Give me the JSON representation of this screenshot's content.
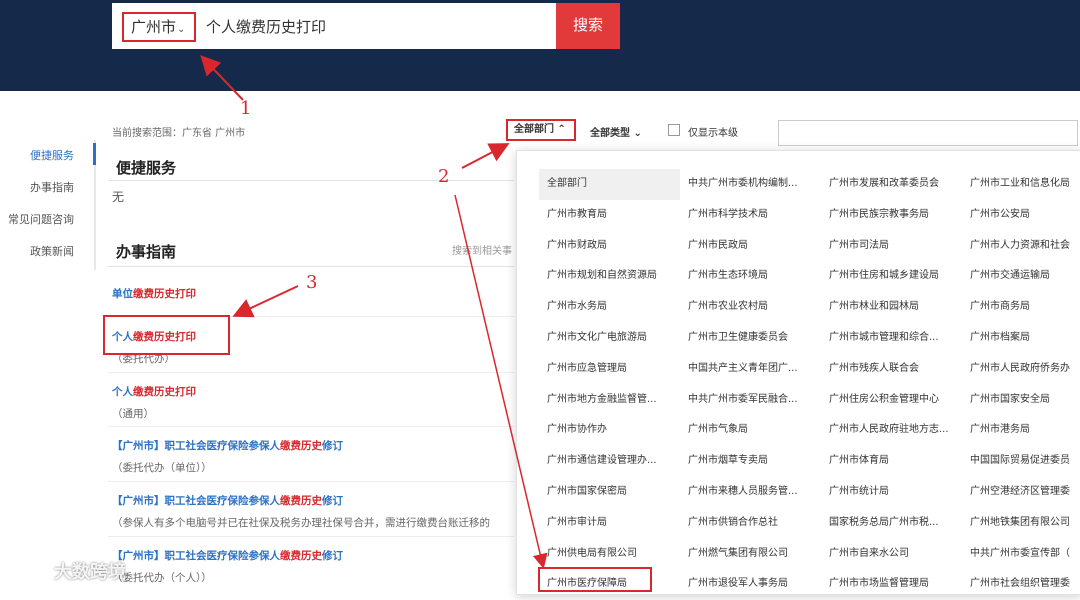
{
  "header": {
    "city": "广州市",
    "search_value": "个人缴费历史打印",
    "search_button": "搜索"
  },
  "left_nav": {
    "items": [
      "便捷服务",
      "办事指南",
      "常见问题咨询",
      "政策新闻"
    ],
    "active": "便捷服务"
  },
  "filters": {
    "scope": "当前搜索范围：广东省 广州市",
    "dept": "全部部门",
    "type": "全部类型",
    "only_this_level": "仅显示本级"
  },
  "sections": {
    "quick_service_title": "便捷服务",
    "quick_service_empty": "无",
    "guide_title": "办事指南",
    "guide_hint": "搜索到相关事"
  },
  "results": [
    {
      "prefix": "单位",
      "highlight": "缴费历史打印",
      "suffix": "",
      "sub": ""
    },
    {
      "prefix": "个人",
      "highlight": "缴费历史打印",
      "suffix": "",
      "sub": "（委托代办）"
    },
    {
      "prefix": "个人",
      "highlight": "缴费历史打印",
      "suffix": "",
      "sub": "（通用）"
    },
    {
      "prefix": "【广州市】职工社会医疗保险参保人",
      "highlight": "缴费历史",
      "suffix": "修订",
      "sub": "（委托代办（单位））"
    },
    {
      "prefix": "【广州市】职工社会医疗保险参保人",
      "highlight": "缴费历史",
      "suffix": "修订",
      "sub": "（参保人有多个电脑号并已在社保及税务办理社保号合并，需进行缴费台账迁移的"
    },
    {
      "prefix": "【广州市】职工社会医疗保险参保人",
      "highlight": "缴费历史",
      "suffix": "修订",
      "sub": "（委托代办（个人））"
    }
  ],
  "departments": [
    "全部部门",
    "中共广州市委机构编制...",
    "广州市发展和改革委员会",
    "广州市工业和信息化局",
    "广州市教育局",
    "广州市科学技术局",
    "广州市民族宗教事务局",
    "广州市公安局",
    "广州市财政局",
    "广州市民政局",
    "广州市司法局",
    "广州市人力资源和社会",
    "广州市规划和自然资源局",
    "广州市生态环境局",
    "广州市住房和城乡建设局",
    "广州市交通运输局",
    "广州市水务局",
    "广州市农业农村局",
    "广州市林业和园林局",
    "广州市商务局",
    "广州市文化广电旅游局",
    "广州市卫生健康委员会",
    "广州市城市管理和综合...",
    "广州市档案局",
    "广州市应急管理局",
    "中国共产主义青年团广...",
    "广州市残疾人联合会",
    "广州市人民政府侨务办",
    "广州市地方金融监督管...",
    "中共广州市委军民融合...",
    "广州住房公积金管理中心",
    "广州市国家安全局",
    "广州市协作办",
    "广州市气象局",
    "广州市人民政府驻地方志...",
    "广州市港务局",
    "广州市通信建设管理办...",
    "广州市烟草专卖局",
    "广州市体育局",
    "中国国际贸易促进委员",
    "广州市国家保密局",
    "广州市来穗人员服务管...",
    "广州市统计局",
    "广州空港经济区管理委",
    "广州市审计局",
    "广州市供销合作总社",
    "国家税务总局广州市税...",
    "广州地铁集团有限公司",
    "广州供电局有限公司",
    "广州燃气集团有限公司",
    "广州市自来水公司",
    "中共广州市委宣传部（",
    "广州市医疗保障局",
    "广州市退役军人事务局",
    "广州市市场监督管理局",
    "广州市社会组织管理委"
  ],
  "annotations": [
    "1",
    "2",
    "3"
  ],
  "watermark": "大数跨境",
  "colors": {
    "header_bg": "#15294b",
    "accent_red": "#d9272e",
    "link_blue": "#2c71c5",
    "button_red": "#e23a3a"
  }
}
